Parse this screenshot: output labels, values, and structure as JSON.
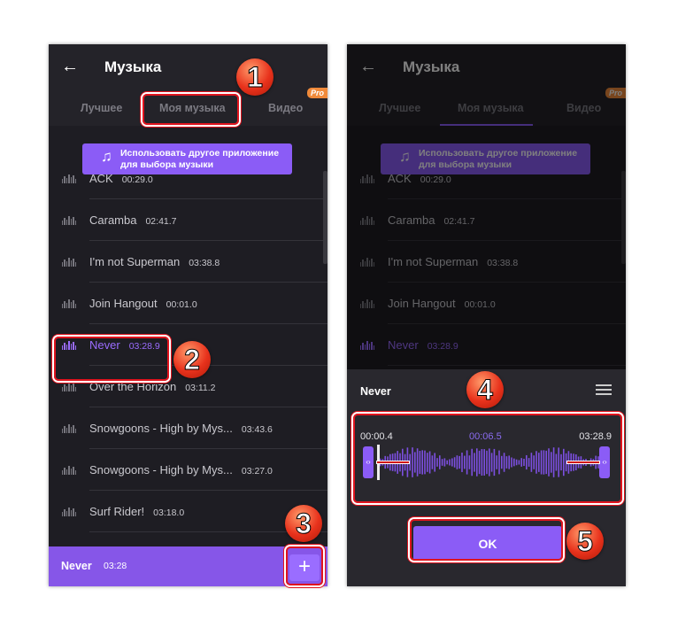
{
  "header": {
    "title": "Музыка",
    "back_icon": "arrow-left-icon"
  },
  "tabs": [
    {
      "label": "Лучшее"
    },
    {
      "label": "Моя музыка"
    },
    {
      "label": "Видео",
      "badge": "Pro"
    }
  ],
  "use_other_app": {
    "line1": "Использовать другое приложение",
    "line2": "для выбора музыки",
    "icon": "music-note-icon"
  },
  "tracks": [
    {
      "name": "ACK",
      "duration": "00:29.0"
    },
    {
      "name": "Caramba",
      "duration": "02:41.7"
    },
    {
      "name": "I'm not Superman",
      "duration": "03:38.8"
    },
    {
      "name": "Join Hangout",
      "duration": "00:01.0"
    },
    {
      "name": "Never",
      "duration": "03:28.9",
      "active": true
    },
    {
      "name": "Over the Horizon",
      "duration": "03:11.2"
    },
    {
      "name": "Snowgoons - High by Mys...",
      "duration": "03:43.6"
    },
    {
      "name": "Snowgoons - High by Mys...",
      "duration": "03:27.0"
    },
    {
      "name": "Surf Rider!",
      "duration": "03:18.0"
    }
  ],
  "bottom_bar": {
    "name": "Never",
    "duration": "03:28",
    "add_label": "+"
  },
  "trim_sheet": {
    "name": "Never",
    "start": "00:00.4",
    "current": "00:06.5",
    "end": "03:28.9",
    "ok_label": "OK",
    "handle_glyph": "‹›"
  },
  "steps": [
    "1",
    "2",
    "3",
    "4",
    "5"
  ],
  "colors": {
    "accent": "#8b5cf6",
    "background": "#1e1d23",
    "highlight": "#e0141e"
  }
}
